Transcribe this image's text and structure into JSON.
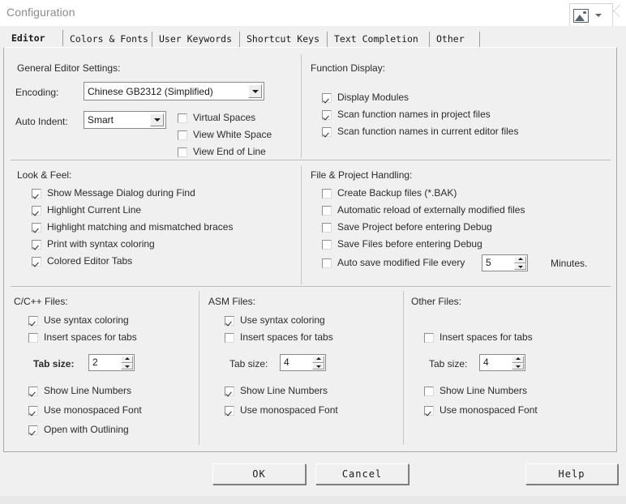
{
  "window": {
    "title": "Configuration",
    "capture_icon": "picture-icon",
    "capture_dropdown_icon": "chevron-down-icon",
    "close_icon": "close-icon"
  },
  "tabs": [
    {
      "label": "Editor",
      "active": true
    },
    {
      "label": "Colors & Fonts",
      "active": false
    },
    {
      "label": "User Keywords",
      "active": false
    },
    {
      "label": "Shortcut Keys",
      "active": false
    },
    {
      "label": "Text Completion",
      "active": false
    },
    {
      "label": "Other",
      "active": false
    }
  ],
  "general_editor": {
    "title": "General Editor Settings:",
    "encoding_label": "Encoding:",
    "encoding_value": "Chinese GB2312 (Simplified)",
    "auto_indent_label": "Auto Indent:",
    "auto_indent_value": "Smart",
    "checks": [
      {
        "label": "Virtual Spaces",
        "checked": false
      },
      {
        "label": "View White Space",
        "checked": false
      },
      {
        "label": "View End of Line",
        "checked": false
      }
    ]
  },
  "function_display": {
    "title": "Function Display:",
    "checks": [
      {
        "label": "Display Modules",
        "checked": true
      },
      {
        "label": "Scan function names in project files",
        "checked": true
      },
      {
        "label": "Scan function names in current editor files",
        "checked": true
      }
    ]
  },
  "look_and_feel": {
    "title": "Look & Feel:",
    "checks": [
      {
        "label": "Show Message Dialog during Find",
        "checked": true
      },
      {
        "label": "Highlight Current Line",
        "checked": true
      },
      {
        "label": "Highlight matching and mismatched braces",
        "checked": true
      },
      {
        "label": "Print with syntax coloring",
        "checked": true
      },
      {
        "label": "Colored Editor Tabs",
        "checked": true
      }
    ]
  },
  "file_project": {
    "title": "File & Project Handling:",
    "checks": [
      {
        "label": "Create Backup files (*.BAK)",
        "checked": false
      },
      {
        "label": "Automatic reload of externally modified files",
        "checked": false
      },
      {
        "label": "Save Project before entering Debug",
        "checked": false
      },
      {
        "label": "Save Files before entering Debug",
        "checked": false
      }
    ],
    "autosave": {
      "label": "Auto save modified File every",
      "checked": false,
      "value": "5",
      "suffix": "Minutes."
    }
  },
  "c_files": {
    "title": "C/C++ Files:",
    "checks_top": [
      {
        "label": "Use syntax coloring",
        "checked": true
      },
      {
        "label": "Insert spaces for tabs",
        "checked": false
      }
    ],
    "tab_size_label": "Tab size:",
    "tab_size_value": "2",
    "checks_bottom": [
      {
        "label": "Show Line Numbers",
        "checked": true
      },
      {
        "label": "Use monospaced Font",
        "checked": true
      },
      {
        "label": "Open with Outlining",
        "checked": true
      }
    ]
  },
  "asm_files": {
    "title": "ASM Files:",
    "checks_top": [
      {
        "label": "Use syntax coloring",
        "checked": true
      },
      {
        "label": "Insert spaces for tabs",
        "checked": false
      }
    ],
    "tab_size_label": "Tab size:",
    "tab_size_value": "4",
    "checks_bottom": [
      {
        "label": "Show Line Numbers",
        "checked": true
      },
      {
        "label": "Use monospaced Font",
        "checked": true
      }
    ]
  },
  "other_files": {
    "title": "Other Files:",
    "checks_top": [
      {
        "label": "Insert spaces for tabs",
        "checked": false
      }
    ],
    "tab_size_label": "Tab size:",
    "tab_size_value": "4",
    "checks_bottom": [
      {
        "label": "Show Line Numbers",
        "checked": false
      },
      {
        "label": "Use monospaced Font",
        "checked": true
      }
    ]
  },
  "footer": {
    "ok": "OK",
    "cancel": "Cancel",
    "help": "Help"
  }
}
